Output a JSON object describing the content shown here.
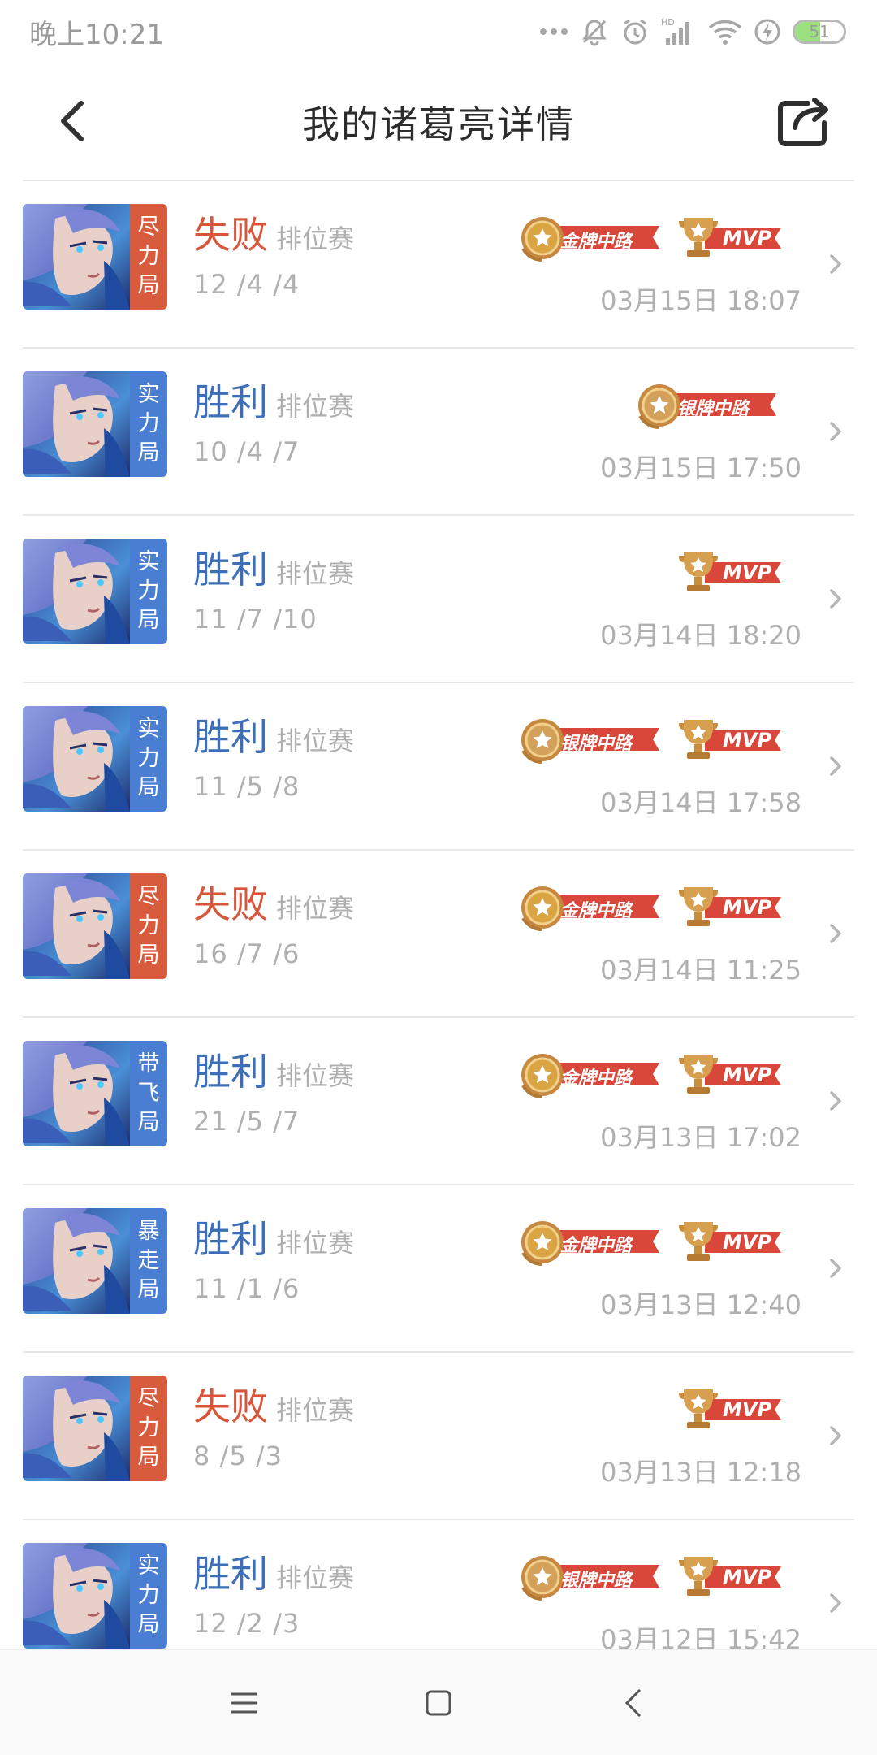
{
  "status_bar": {
    "time": "晚上10:21",
    "battery_level": "51",
    "battery_fraction": 0.51,
    "icons": [
      "more-dots-icon",
      "silent-icon",
      "alarm-icon",
      "hd-signal-icon",
      "wifi-icon",
      "charging-icon",
      "battery-icon"
    ]
  },
  "header": {
    "title": "我的诸葛亮详情",
    "back_icon": "back-arrow-icon",
    "share_icon": "share-icon"
  },
  "colors": {
    "win": "#3d6fb8",
    "lose": "#d9553a",
    "tier_red": "#d95b3d",
    "tier_blue": "#4a7ed3",
    "muted": "#b0b0b0",
    "badge_red": "#d94a3a",
    "badge_gold": "#c9954a"
  },
  "matches": [
    {
      "tier": [
        "尽",
        "力",
        "局"
      ],
      "tier_color": "red",
      "result": "失败",
      "outcome": "lose",
      "mode": "排位赛",
      "kda": "12 /4 /4",
      "datetime": "03月15日 18:07",
      "badges": [
        {
          "type": "lane",
          "label": "金牌中路",
          "medal": "gold"
        },
        {
          "type": "mvp",
          "label": "MVP"
        }
      ]
    },
    {
      "tier": [
        "实",
        "力",
        "局"
      ],
      "tier_color": "blue",
      "result": "胜利",
      "outcome": "win",
      "mode": "排位赛",
      "kda": "10 /4 /7",
      "datetime": "03月15日 17:50",
      "badges": [
        {
          "type": "lane",
          "label": "银牌中路",
          "medal": "silver"
        }
      ]
    },
    {
      "tier": [
        "实",
        "力",
        "局"
      ],
      "tier_color": "blue",
      "result": "胜利",
      "outcome": "win",
      "mode": "排位赛",
      "kda": "11 /7 /10",
      "datetime": "03月14日 18:20",
      "badges": [
        {
          "type": "mvp",
          "label": "MVP"
        }
      ]
    },
    {
      "tier": [
        "实",
        "力",
        "局"
      ],
      "tier_color": "blue",
      "result": "胜利",
      "outcome": "win",
      "mode": "排位赛",
      "kda": "11 /5 /8",
      "datetime": "03月14日 17:58",
      "badges": [
        {
          "type": "lane",
          "label": "银牌中路",
          "medal": "silver"
        },
        {
          "type": "mvp",
          "label": "MVP"
        }
      ]
    },
    {
      "tier": [
        "尽",
        "力",
        "局"
      ],
      "tier_color": "red",
      "result": "失败",
      "outcome": "lose",
      "mode": "排位赛",
      "kda": "16 /7 /6",
      "datetime": "03月14日 11:25",
      "badges": [
        {
          "type": "lane",
          "label": "金牌中路",
          "medal": "gold"
        },
        {
          "type": "mvp",
          "label": "MVP"
        }
      ]
    },
    {
      "tier": [
        "带",
        "飞",
        "局"
      ],
      "tier_color": "blue",
      "result": "胜利",
      "outcome": "win",
      "mode": "排位赛",
      "kda": "21 /5 /7",
      "datetime": "03月13日 17:02",
      "badges": [
        {
          "type": "lane",
          "label": "金牌中路",
          "medal": "gold"
        },
        {
          "type": "mvp",
          "label": "MVP"
        }
      ]
    },
    {
      "tier": [
        "暴",
        "走",
        "局"
      ],
      "tier_color": "blue",
      "result": "胜利",
      "outcome": "win",
      "mode": "排位赛",
      "kda": "11 /1 /6",
      "datetime": "03月13日 12:40",
      "badges": [
        {
          "type": "lane",
          "label": "金牌中路",
          "medal": "gold"
        },
        {
          "type": "mvp",
          "label": "MVP"
        }
      ]
    },
    {
      "tier": [
        "尽",
        "力",
        "局"
      ],
      "tier_color": "red",
      "result": "失败",
      "outcome": "lose",
      "mode": "排位赛",
      "kda": "8 /5 /3",
      "datetime": "03月13日 12:18",
      "badges": [
        {
          "type": "mvp",
          "label": "MVP"
        }
      ]
    },
    {
      "tier": [
        "实",
        "力",
        "局"
      ],
      "tier_color": "blue",
      "result": "胜利",
      "outcome": "win",
      "mode": "排位赛",
      "kda": "12 /2 /3",
      "datetime": "03月12日 15:42",
      "badges": [
        {
          "type": "lane",
          "label": "银牌中路",
          "medal": "silver"
        },
        {
          "type": "mvp",
          "label": "MVP"
        }
      ]
    }
  ],
  "nav_bar": {
    "icons": [
      "menu-icon",
      "home-icon",
      "back-icon"
    ]
  }
}
